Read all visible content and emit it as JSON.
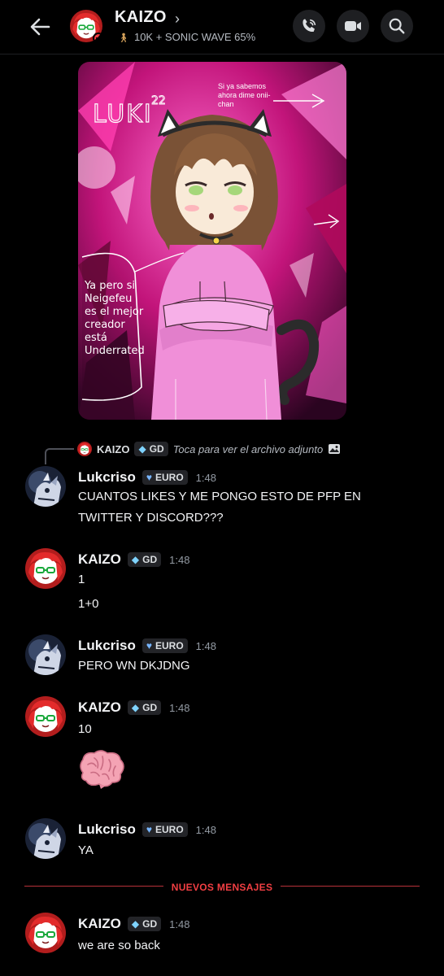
{
  "header": {
    "title": "KAIZO",
    "status": "10K + SONIC WAVE 65%",
    "icons": [
      "back-arrow-icon",
      "call-icon",
      "video-icon",
      "search-icon"
    ]
  },
  "attachment": {
    "signature": "LUKI",
    "signature_sup": "22",
    "caption_top": "Si ya sabemos ahora dime onii-chan",
    "caption_left": [
      "Ya pero si",
      "Neigefeu",
      "es el mejor",
      "creador",
      "está",
      "Underrated"
    ]
  },
  "reply": {
    "name": "KAIZO",
    "tag": "GD",
    "text": "Toca para ver el archivo adjunto"
  },
  "messages": [
    {
      "user": "Lukcriso",
      "tag": "EURO",
      "time": "1:48",
      "lines": [
        "CUANTOS LIKES Y ME PONGO ESTO DE PFP EN",
        "TWITTER Y DISCORD???"
      ]
    },
    {
      "user": "KAIZO",
      "tag": "GD",
      "time": "1:48",
      "lines": [
        "1",
        "1+0"
      ]
    },
    {
      "user": "Lukcriso",
      "tag": "EURO",
      "time": "1:48",
      "lines": [
        "PERO WN DKJDNG"
      ]
    },
    {
      "user": "KAIZO",
      "tag": "GD",
      "time": "1:48",
      "lines": [
        "10"
      ],
      "emoji": "brain-emoji"
    },
    {
      "user": "Lukcriso",
      "tag": "EURO",
      "time": "1:48",
      "lines": [
        "YA"
      ]
    },
    {
      "user": "KAIZO",
      "tag": "GD",
      "time": "1:48",
      "lines": [
        "we are so back"
      ]
    }
  ],
  "divider": {
    "label": "NUEVOS MENSAJES"
  },
  "colors": {
    "background": "#000000",
    "new_messages": "#f23f43",
    "tag_bg": "#232428"
  }
}
